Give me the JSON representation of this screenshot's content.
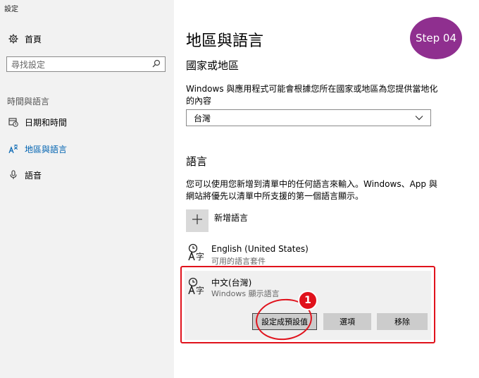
{
  "window": {
    "title": "設定"
  },
  "sidebar": {
    "home_label": "首頁",
    "search_placeholder": "尋找設定",
    "section_label": "時間與語言",
    "items": [
      {
        "label": "日期和時間",
        "icon": "calendar-clock-icon",
        "active": false
      },
      {
        "label": "地區與語言",
        "icon": "language-icon",
        "active": true
      },
      {
        "label": "語音",
        "icon": "microphone-icon",
        "active": false
      }
    ]
  },
  "main": {
    "title": "地區與語言",
    "country_heading": "國家或地區",
    "country_desc_1": "Windows 與應用程式可能會根據您所在國家或地區為您提供當地化",
    "country_desc_2": "的內容",
    "country_value": "台灣",
    "language_heading": "語言",
    "language_desc_1": "您可以使用您新增到清單中的任何語言來輸入。Windows、App 與",
    "language_desc_2": "網站將優先以清單中所支援的第一個語言顯示。",
    "add_language_label": "新增語言",
    "languages": [
      {
        "name": "English (United States)",
        "sub": "可用的語言套件"
      },
      {
        "name": "中文(台灣)",
        "sub": "Windows 顯示語言"
      }
    ],
    "buttons": {
      "set_default": "設定成預設值",
      "options": "選項",
      "remove": "移除"
    }
  },
  "annotations": {
    "step_badge": "Step 04",
    "step_number": "1",
    "accent_color": "#e0121c",
    "badge_color": "#8f2f8f"
  }
}
